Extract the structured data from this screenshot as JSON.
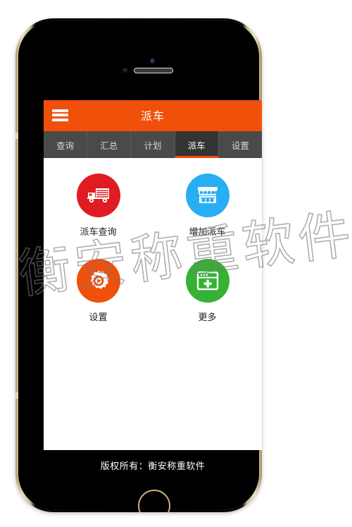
{
  "device": {
    "frame_color": "#cbb98e",
    "bezel_color": "#000000",
    "home_button_name": "home-button"
  },
  "header": {
    "title": "派车",
    "background": "#f1500a",
    "menu_icon": "hamburger-icon"
  },
  "tabs": [
    {
      "label": "查询",
      "active": false
    },
    {
      "label": "汇总",
      "active": false
    },
    {
      "label": "计划",
      "active": false
    },
    {
      "label": "派车",
      "active": true
    },
    {
      "label": "设置",
      "active": false
    }
  ],
  "tab_bar": {
    "background": "#4a4a4a",
    "active_background": "#343434",
    "indicator_color": "#f1500a"
  },
  "tiles": [
    {
      "label": "派车查询",
      "icon": "truck-icon",
      "color": "#e01b22"
    },
    {
      "label": "增加派车",
      "icon": "store-icon",
      "color": "#27aef3"
    },
    {
      "label": "设置",
      "icon": "gear-icon",
      "color": "#f1500a"
    },
    {
      "label": "更多",
      "icon": "window-plus-icon",
      "color": "#35b233"
    }
  ],
  "footer": {
    "text": "版权所有：衡安称重软件"
  },
  "watermark": {
    "text": "衡安称重软件"
  }
}
